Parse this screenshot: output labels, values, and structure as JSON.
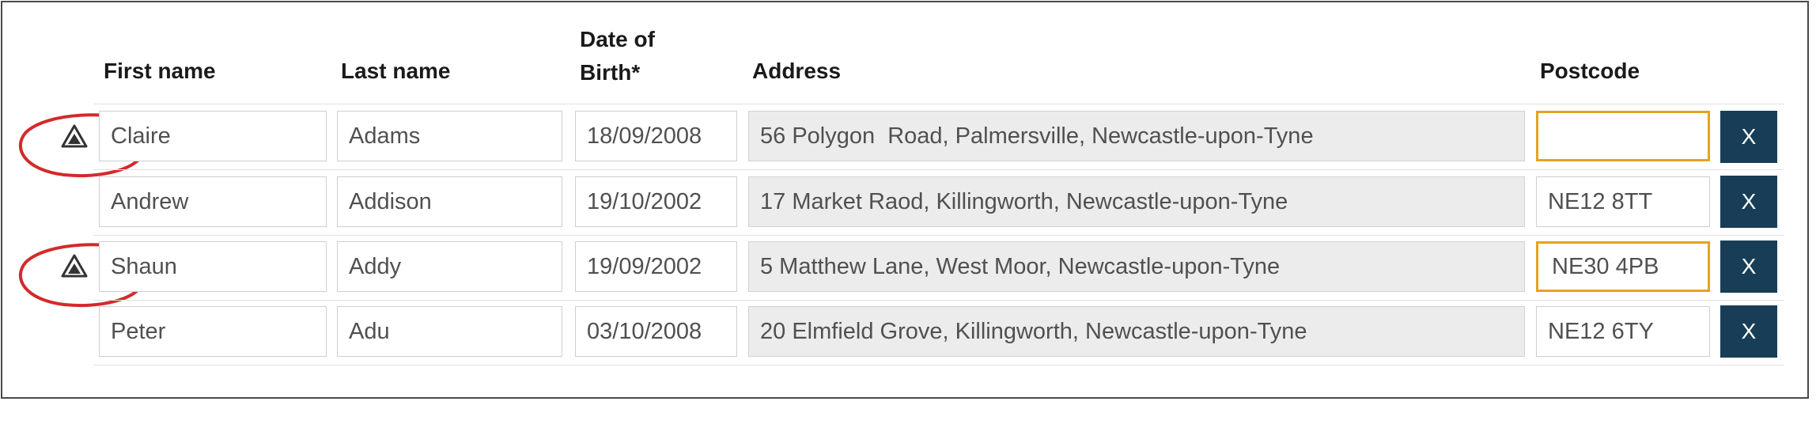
{
  "headers": {
    "first_name": "First name",
    "last_name": "Last name",
    "dob_line1": "Date of",
    "dob_line2": "Birth*",
    "address": "Address",
    "postcode": "Postcode"
  },
  "rows": [
    {
      "first_name": "Claire",
      "last_name": "Adams",
      "dob": "18/09/2008",
      "address": "56 Polygon  Road, Palmersville, Newcastle-upon-Tyne",
      "postcode": "",
      "warning": true,
      "remove_label": "X"
    },
    {
      "first_name": "Andrew",
      "last_name": "Addison",
      "dob": "19/10/2002",
      "address": "17 Market Raod, Killingworth, Newcastle-upon-Tyne",
      "postcode": "NE12 8TT",
      "warning": false,
      "remove_label": "X"
    },
    {
      "first_name": "Shaun",
      "last_name": "Addy",
      "dob": "19/09/2002",
      "address": "5 Matthew Lane, West Moor, Newcastle-upon-Tyne",
      "postcode": "NE30 4PB",
      "warning": true,
      "remove_label": "X"
    },
    {
      "first_name": "Peter",
      "last_name": "Adu",
      "dob": "03/10/2008",
      "address": "20 Elmfield Grove, Killingworth, Newcastle-upon-Tyne",
      "postcode": "NE12 6TY",
      "warning": false,
      "remove_label": "X"
    }
  ],
  "colors": {
    "warning_border": "#e3a420",
    "remove_button": "#183e57",
    "annotation_circle": "#d42a2a",
    "address_fill": "#ececec"
  },
  "icons": {
    "warning": "warning-triangle-icon",
    "annotation": "red-circle-annotation"
  }
}
